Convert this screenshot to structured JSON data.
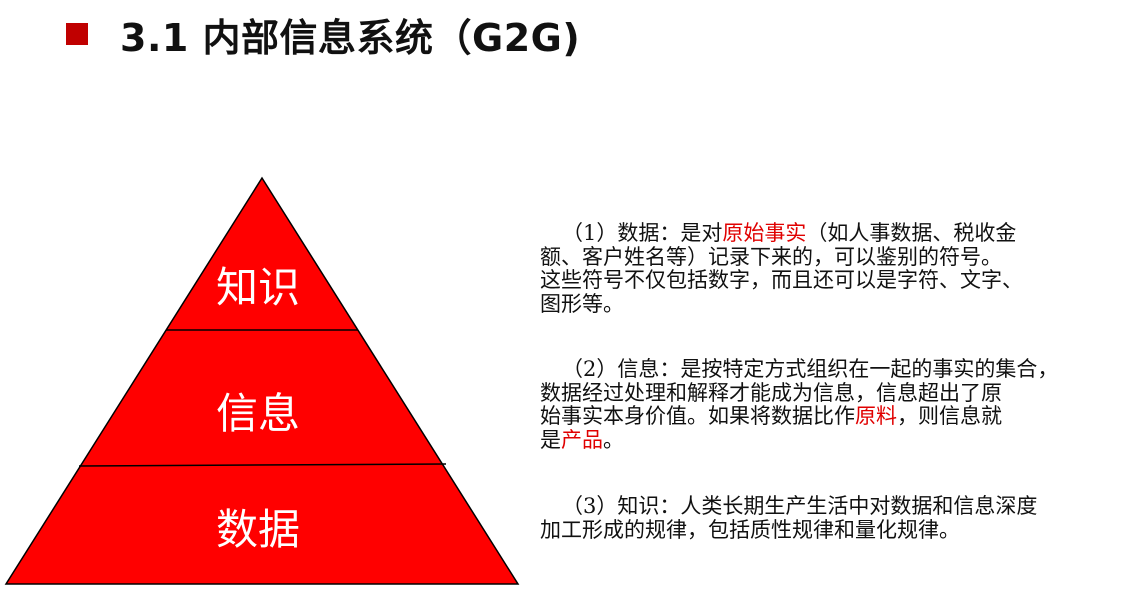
{
  "colors": {
    "accent": "#c00000",
    "pyramid_fill": "#ff0000",
    "highlight": "#e00000"
  },
  "header": {
    "title": "3.1 内部信息系统（G2G)"
  },
  "pyramid": {
    "levels": [
      "知识",
      "信息",
      "数据"
    ]
  },
  "descriptions": [
    {
      "lines": [
        [
          "（1）数据：是对",
          "原始事实",
          "（如人事数据、税收金"
        ],
        [
          "额、客户姓名等）记录下来的，可以鉴别的符号。"
        ],
        [
          "这些符号不仅包括数字，而且还可以是字符、文字、"
        ],
        [
          "图形等。"
        ]
      ]
    },
    {
      "lines": [
        [
          "（2）信息：是按特定方式组织在一起的事实的集合，"
        ],
        [
          "数据经过处理和解释才能成为信息，信息超出了原"
        ],
        [
          "始事实本身价值。如果将数据比作",
          "原料",
          "，则信息就"
        ],
        [
          "是",
          "产品",
          "。"
        ]
      ]
    },
    {
      "lines": [
        [
          "（3）知识：人类长期生产生活中对数据和信息深度"
        ],
        [
          "加工形成的规律，包括质性规律和量化规律。"
        ]
      ]
    }
  ]
}
